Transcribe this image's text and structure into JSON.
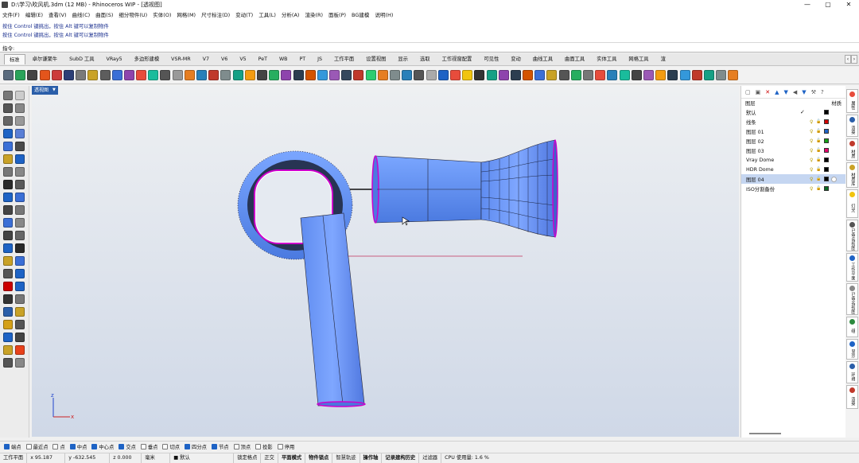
{
  "window": {
    "title": "D:\\学习\\吹风机.3dm (12 MB) - Rhinoceros WIP - [透视图]"
  },
  "menu": [
    "文件(F)",
    "编辑(E)",
    "查看(V)",
    "曲线(C)",
    "曲面(S)",
    "细分物件(U)",
    "实体(O)",
    "网格(M)",
    "尺寸标注(D)",
    "变动(T)",
    "工具(L)",
    "分析(A)",
    "渲染(R)",
    "面板(P)",
    "BG建模",
    "说明(H)"
  ],
  "command_history": [
    "按住 Control 键挑出，按住 Alt 键可以复制物件",
    "按住 Control 键挑出，按住 Alt 键可以复制物件"
  ],
  "command_prompt": "指令:",
  "tabs": [
    "标准",
    "卓尔谦聚牛",
    "SubD 工具",
    "VRay5",
    "多边形建模",
    "VSR-MR",
    "V7",
    "V6",
    "V5",
    "PeT",
    "WB",
    "PT",
    "JS",
    "工作平面",
    "设置视图",
    "显示",
    "选取",
    "工作视窗配置",
    "可见性",
    "变动",
    "曲线工具",
    "曲面工具",
    "实体工具",
    "网格工具",
    "渲"
  ],
  "viewport": {
    "label": "透视图",
    "axes": {
      "x": "x",
      "z": "z"
    }
  },
  "layers_panel": {
    "header_left": "图层",
    "header_right": "材质",
    "items": [
      {
        "name": "默认",
        "check": "✓",
        "color": "#000000"
      },
      {
        "name": "线条",
        "color": "#d40000"
      },
      {
        "name": "图层 01",
        "color": "#1e63c5"
      },
      {
        "name": "图层 02",
        "color": "#16a016"
      },
      {
        "name": "图层 03",
        "color": "#e6006b"
      },
      {
        "name": "Vray Dome",
        "color": "#000000"
      },
      {
        "name": "HDR Dome",
        "color": "#000000"
      },
      {
        "name": "图层 04",
        "color": "#000000",
        "selected": true
      },
      {
        "name": "ISO分割备份",
        "color": "#0b6b24"
      }
    ]
  },
  "side_tabs": [
    "属性",
    "渲染",
    "材质",
    "材质库",
    "灯光",
    "已命名视图",
    "工作平面",
    "已命名视图",
    "组",
    "显示",
    "环境",
    "渲染"
  ],
  "snap": [
    {
      "label": "端点",
      "on": true
    },
    {
      "label": "最近点",
      "on": false
    },
    {
      "label": "点",
      "on": false
    },
    {
      "label": "中点",
      "on": true
    },
    {
      "label": "中心点",
      "on": true
    },
    {
      "label": "交点",
      "on": true
    },
    {
      "label": "垂点",
      "on": false
    },
    {
      "label": "切点",
      "on": false
    },
    {
      "label": "四分点",
      "on": true
    },
    {
      "label": "节点",
      "on": true
    },
    {
      "label": "顶点",
      "on": false
    },
    {
      "label": "投影",
      "on": false
    },
    {
      "label": "停用",
      "on": false
    }
  ],
  "status": {
    "cplane": "工作平面",
    "x": "x 95.187",
    "y": "y -632.545",
    "z": "z 0.000",
    "unit": "毫米",
    "layer": "默认",
    "grid_snap": "锁定格点",
    "ortho": "正交",
    "planar": "平面模式",
    "osnap": "物件锁点",
    "smarttrack": "智慧轨迹",
    "gumball": "操作轴",
    "history": "记录建构历史",
    "filter": "过滤器",
    "cpu": "CPU 使用量: 1.6 %"
  },
  "colors": {
    "model_blue": "#5b8df2",
    "edge_magenta": "#cc00cc",
    "viewport_tab": "#2a5ea9"
  }
}
